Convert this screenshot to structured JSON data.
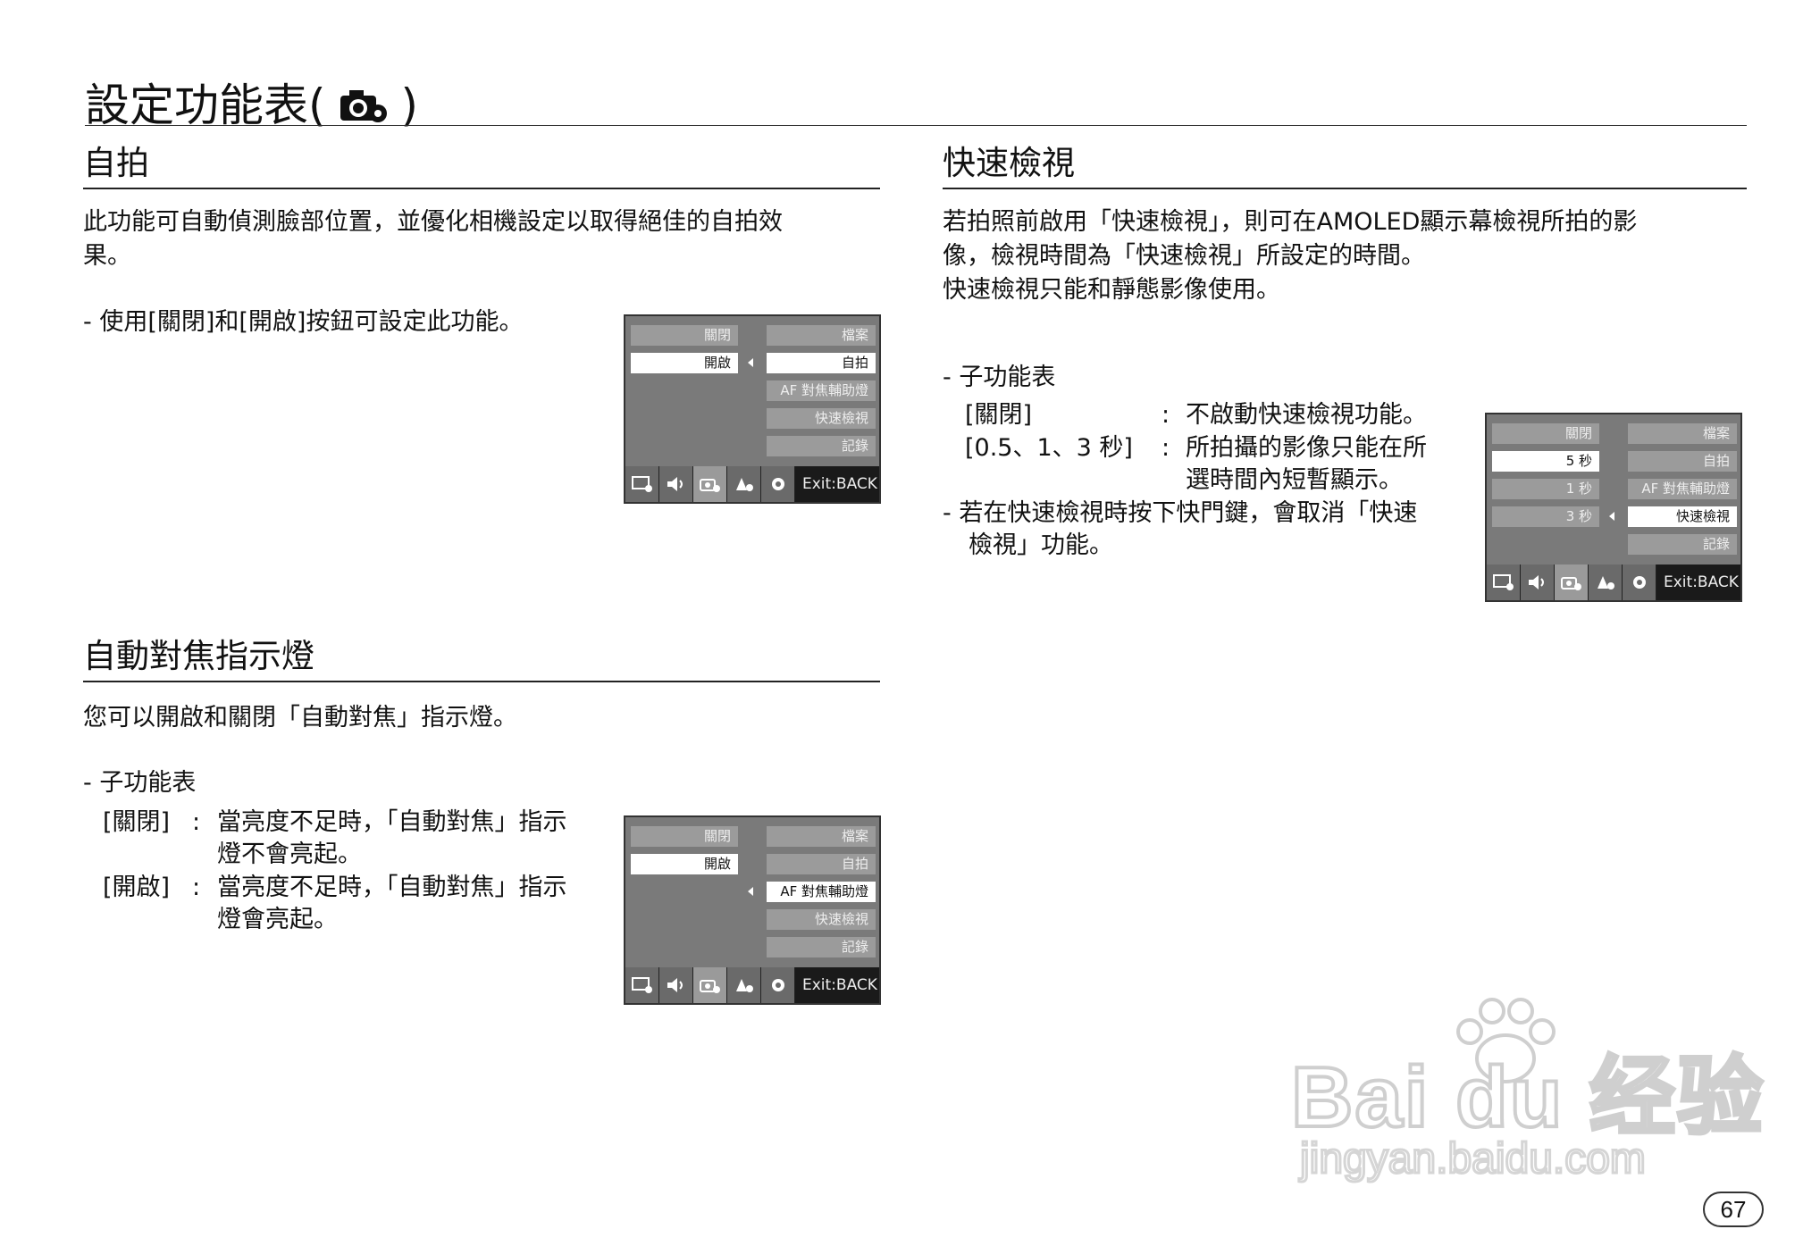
{
  "page": {
    "title_prefix": "設定功能表(",
    "title_suffix": ")",
    "page_number": "67"
  },
  "selfie": {
    "heading": "自拍",
    "desc_line1": "此功能可自動偵測臉部位置，並優化相機設定以取得絕佳的自拍效",
    "desc_line2": "果。",
    "bullet": "- 使用[關閉]和[開啟]按鈕可設定此功能。"
  },
  "af_lamp": {
    "heading": "自動對焦指示燈",
    "desc": "您可以開啟和關閉「自動對焦」指示燈。",
    "submenu_label": "- 子功能表",
    "items": [
      {
        "key": "[關閉]",
        "colon": ":",
        "line1": "當亮度不足時，「自動對焦」指示",
        "line2": "燈不會亮起。"
      },
      {
        "key": "[開啟]",
        "colon": ":",
        "line1": "當亮度不足時，「自動對焦」指示",
        "line2": "燈會亮起。"
      }
    ]
  },
  "quick_view": {
    "heading": "快速檢視",
    "desc_line1": "若拍照前啟用「快速檢視」，則可在AMOLED顯示幕檢視所拍的影",
    "desc_line2": "像，檢視時間為「快速檢視」所設定的時間。",
    "desc_line3": "快速檢視只能和靜態影像使用。",
    "submenu_label": "- 子功能表",
    "items": [
      {
        "key": "[關閉]",
        "colon": ":",
        "line1": "不啟動快速檢視功能。",
        "line2": ""
      },
      {
        "key": "[0.5、1、3 秒]",
        "colon": ":",
        "line1": "所拍攝的影像只能在所",
        "line2": "選時間內短暫顯示。"
      }
    ],
    "note_line1": "- 若在快速檢視時按下快門鍵，會取消「快速",
    "note_line2": "檢視」功能。"
  },
  "screens": {
    "right_menu": [
      "檔案",
      "自拍",
      "AF 對焦輔助燈",
      "快速檢視",
      "記錄"
    ],
    "exit_label": "Exit:BACK",
    "selfie_options": [
      "關閉",
      "開啟"
    ],
    "af_options": [
      "關閉",
      "開啟"
    ],
    "qv_options": [
      "關閉",
      "5 秒",
      "1 秒",
      "3 秒"
    ]
  },
  "watermark": {
    "brand": "Bai du 经验",
    "url": "jingyan.baidu.com"
  }
}
